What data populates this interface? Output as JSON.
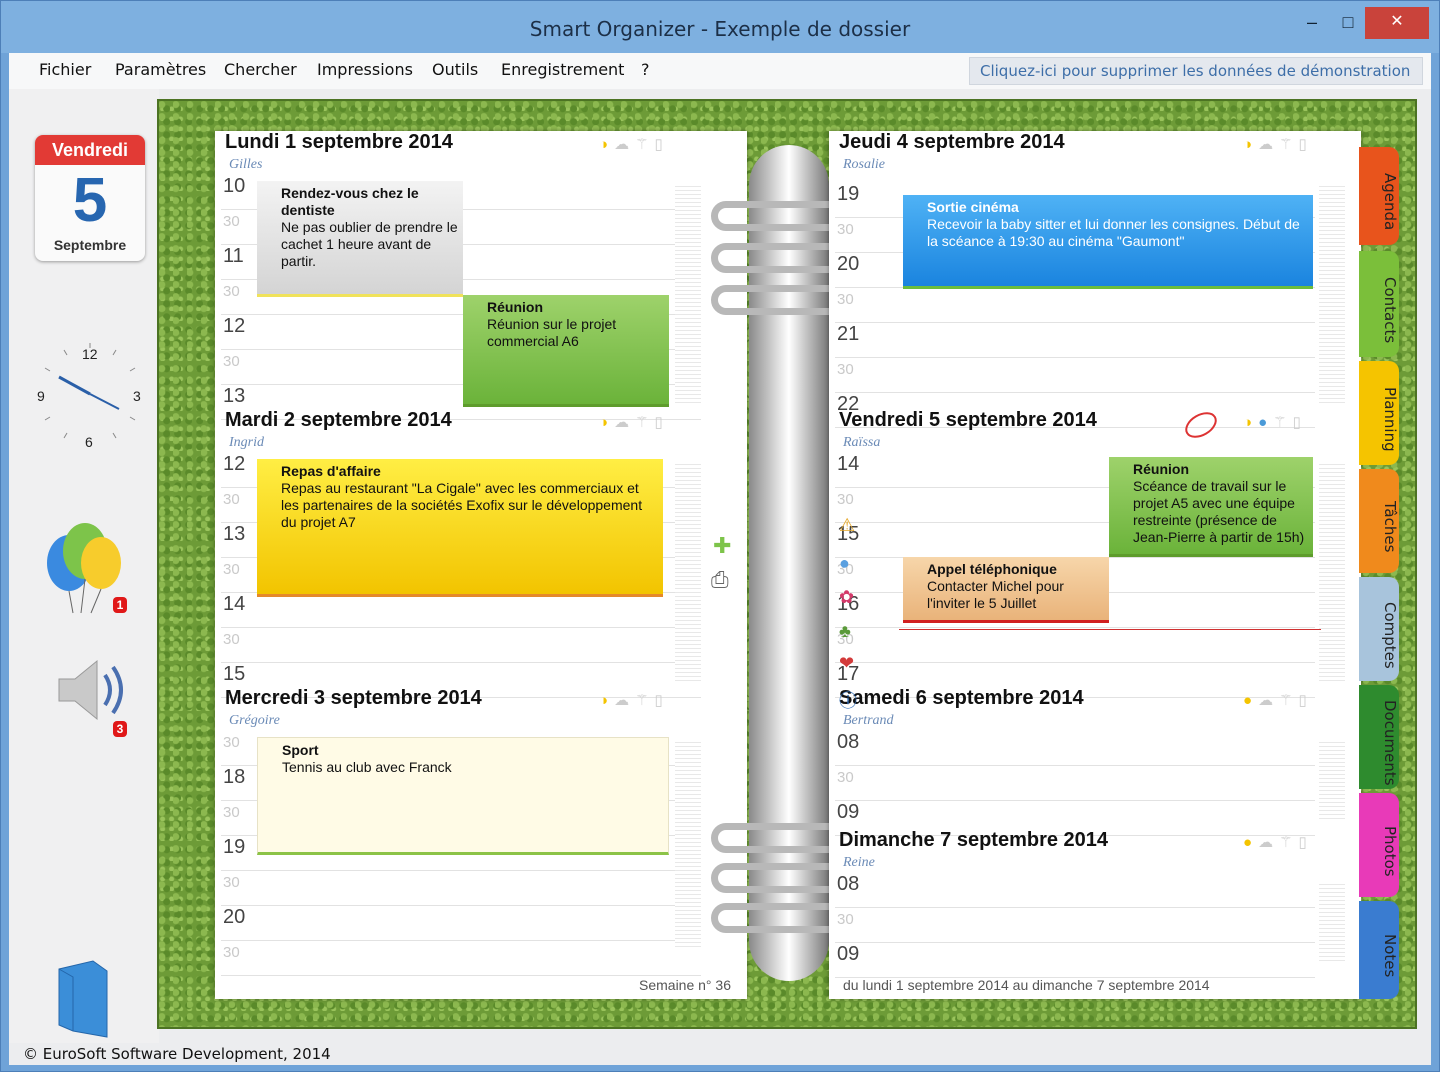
{
  "window": {
    "title": "Smart Organizer - Exemple de dossier",
    "minimize": "–",
    "maximize": "□",
    "close": "✕"
  },
  "menu": [
    "Fichier",
    "Paramètres",
    "Chercher",
    "Impressions",
    "Outils",
    "Enregistrement",
    "?"
  ],
  "demo_link": "Cliquez-ici pour supprimer les données de démonstration",
  "today": {
    "weekday": "Vendredi",
    "day": "5",
    "month": "Septembre"
  },
  "clock": {
    "n12": "12",
    "n3": "3",
    "n6": "6",
    "n9": "9"
  },
  "badges": {
    "balloons": "1",
    "speaker": "3"
  },
  "days": {
    "mon": {
      "title": "Lundi 1 septembre 2014",
      "saint": "Gilles",
      "hours": [
        "10",
        "30",
        "11",
        "30",
        "12",
        "30",
        "13"
      ]
    },
    "tue": {
      "title": "Mardi 2 septembre 2014",
      "saint": "Ingrid",
      "hours": [
        "12",
        "30",
        "13",
        "30",
        "14",
        "30",
        "15"
      ]
    },
    "wed": {
      "title": "Mercredi 3 septembre 2014",
      "saint": "Grégoire",
      "hours": [
        "30",
        "18",
        "30",
        "19",
        "30",
        "20",
        "30"
      ]
    },
    "thu": {
      "title": "Jeudi 4 septembre 2014",
      "saint": "Rosalie",
      "hours": [
        "19",
        "30",
        "20",
        "30",
        "21",
        "30",
        "22"
      ]
    },
    "fri": {
      "title": "Vendredi 5 septembre 2014",
      "saint": "Raïssa",
      "hours": [
        "14",
        "30",
        "15",
        "30",
        "16",
        "30",
        "17"
      ]
    },
    "sat": {
      "title": "Samedi 6 septembre 2014",
      "saint": "Bertrand",
      "hours": [
        "08",
        "30",
        "09"
      ]
    },
    "sun": {
      "title": "Dimanche 7 septembre 2014",
      "saint": "Reine",
      "hours": [
        "08",
        "30",
        "09"
      ]
    }
  },
  "events": {
    "dentist": {
      "title": "Rendez-vous chez le dentiste",
      "body": "Ne pas oublier de prendre le cachet 1 heure avant de partir."
    },
    "reunion1": {
      "title": "Réunion",
      "body": "Réunion sur le projet commercial A6"
    },
    "repas": {
      "title": "Repas d'affaire",
      "body": "Repas au restaurant \"La Cigale\" avec les commerciaux et les partenaires de la sociétés Exofix sur le développement du projet A7"
    },
    "sport": {
      "title": "Sport",
      "body": "Tennis au club avec Franck"
    },
    "cinema": {
      "title": "Sortie cinéma",
      "body": "Recevoir la baby sitter et lui donner les consignes. Début de la scéance à 19:30 au cinéma \"Gaumont\""
    },
    "reunion2": {
      "title": "Réunion",
      "body": "Scéance de travail sur le projet A5 avec une équipe restreinte (présence de Jean-Pierre à partir de 15h)"
    },
    "appel": {
      "title": "Appel téléphonique",
      "body": "Contacter Michel pour l'inviter le 5 Juillet"
    }
  },
  "footer": {
    "week": "Semaine n° 36",
    "range": "du lundi 1 septembre 2014 au dimanche 7 septembre 2014"
  },
  "tabs": [
    "Agenda",
    "Contacts",
    "Planning",
    "Tâches",
    "Comptes",
    "Documents",
    "Photos",
    "Notes"
  ],
  "tab_colors": [
    "#e8541c",
    "#7bbf3a",
    "#f5c400",
    "#f08a1c",
    "#a8c4dc",
    "#2e8b2e",
    "#e83ab8",
    "#3a7cd0"
  ],
  "status": "© EuroSoft Software Development, 2014"
}
